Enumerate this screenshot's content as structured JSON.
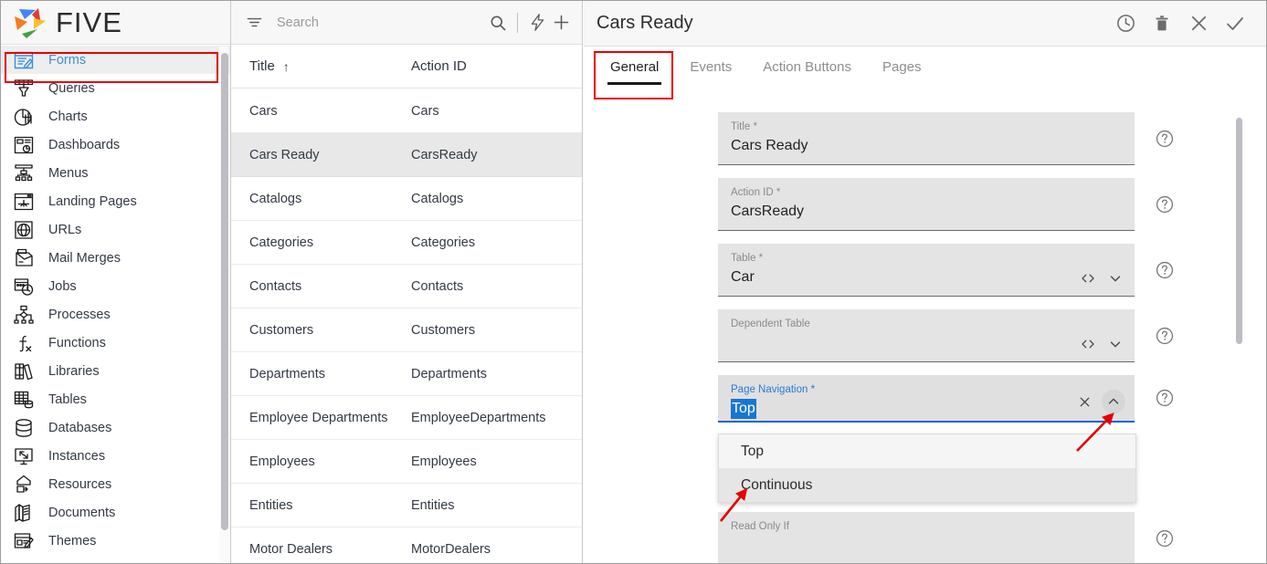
{
  "app": {
    "logo_text": "FIVE",
    "accent_red": "#e60000",
    "accent_blue": "#1876d2",
    "selected_row_bg": "#e8e8e8"
  },
  "sidebar": {
    "items": [
      {
        "label": "Forms",
        "icon": "forms-icon",
        "selected": true
      },
      {
        "label": "Queries",
        "icon": "queries-icon",
        "selected": false
      },
      {
        "label": "Charts",
        "icon": "charts-icon",
        "selected": false
      },
      {
        "label": "Dashboards",
        "icon": "dashboards-icon",
        "selected": false
      },
      {
        "label": "Menus",
        "icon": "menus-icon",
        "selected": false
      },
      {
        "label": "Landing Pages",
        "icon": "landing-pages-icon",
        "selected": false
      },
      {
        "label": "URLs",
        "icon": "urls-icon",
        "selected": false
      },
      {
        "label": "Mail Merges",
        "icon": "mail-merges-icon",
        "selected": false
      },
      {
        "label": "Jobs",
        "icon": "jobs-icon",
        "selected": false
      },
      {
        "label": "Processes",
        "icon": "processes-icon",
        "selected": false
      },
      {
        "label": "Functions",
        "icon": "functions-icon",
        "selected": false
      },
      {
        "label": "Libraries",
        "icon": "libraries-icon",
        "selected": false
      },
      {
        "label": "Tables",
        "icon": "tables-icon",
        "selected": false
      },
      {
        "label": "Databases",
        "icon": "databases-icon",
        "selected": false
      },
      {
        "label": "Instances",
        "icon": "instances-icon",
        "selected": false
      },
      {
        "label": "Resources",
        "icon": "resources-icon",
        "selected": false
      },
      {
        "label": "Documents",
        "icon": "documents-icon",
        "selected": false
      },
      {
        "label": "Themes",
        "icon": "themes-icon",
        "selected": false
      }
    ]
  },
  "list_pane": {
    "search": {
      "placeholder": "Search",
      "value": ""
    },
    "toolbar_icons": [
      "filter-icon",
      "search-icon",
      "lightning-icon",
      "plus-icon"
    ],
    "columns": [
      {
        "label": "Title",
        "sort": "ascending",
        "sort_glyph": "↑"
      },
      {
        "label": "Action ID",
        "sort": "none",
        "sort_glyph": ""
      }
    ],
    "rows": [
      {
        "title": "Cars",
        "action_id": "Cars",
        "selected": false
      },
      {
        "title": "Cars Ready",
        "action_id": "CarsReady",
        "selected": true
      },
      {
        "title": "Catalogs",
        "action_id": "Catalogs",
        "selected": false
      },
      {
        "title": "Categories",
        "action_id": "Categories",
        "selected": false
      },
      {
        "title": "Contacts",
        "action_id": "Contacts",
        "selected": false
      },
      {
        "title": "Customers",
        "action_id": "Customers",
        "selected": false
      },
      {
        "title": "Departments",
        "action_id": "Departments",
        "selected": false
      },
      {
        "title": "Employee Departments",
        "action_id": "EmployeeDepartments",
        "selected": false
      },
      {
        "title": "Employees",
        "action_id": "Employees",
        "selected": false
      },
      {
        "title": "Entities",
        "action_id": "Entities",
        "selected": false
      },
      {
        "title": "Motor Dealers",
        "action_id": "MotorDealers",
        "selected": false
      }
    ]
  },
  "detail": {
    "title": "Cars Ready",
    "header_icons": [
      "history-clock-icon",
      "delete-trash-icon",
      "close-x-icon",
      "confirm-check-icon"
    ],
    "tabs": [
      {
        "label": "General",
        "active": true
      },
      {
        "label": "Events",
        "active": false
      },
      {
        "label": "Action Buttons",
        "active": false
      },
      {
        "label": "Pages",
        "active": false
      }
    ],
    "fields": [
      {
        "label": "Title *",
        "value": "Cars Ready",
        "adornments": [],
        "focused": false,
        "selected_text": false
      },
      {
        "label": "Action ID *",
        "value": "CarsReady",
        "adornments": [],
        "focused": false,
        "selected_text": false
      },
      {
        "label": "Table *",
        "value": "Car",
        "adornments": [
          "code-icon",
          "chevron-down-icon"
        ],
        "focused": false,
        "selected_text": false
      },
      {
        "label": "Dependent Table",
        "value": "",
        "adornments": [
          "code-icon",
          "chevron-down-icon"
        ],
        "focused": false,
        "selected_text": false
      },
      {
        "label": "Page Navigation *",
        "value": "Top",
        "adornments": [
          "clear-x-icon",
          "chevron-up-icon"
        ],
        "focused": true,
        "selected_text": true
      },
      {
        "label": "Read Only If",
        "value": "",
        "adornments": [],
        "focused": false,
        "selected_text": false
      }
    ],
    "dropdown": {
      "open": true,
      "options": [
        {
          "label": "Top",
          "state": "selected"
        },
        {
          "label": "Continuous",
          "state": "hovered"
        }
      ]
    },
    "help_icon": "question-mark-help-icon"
  },
  "annotations": {
    "boxes": [
      {
        "target": "sidebar-item-forms",
        "color": "#e60000"
      },
      {
        "target": "tab-general",
        "color": "#e60000"
      }
    ],
    "arrows": [
      {
        "target": "page-navigation-chevron-up",
        "color": "#e60000"
      },
      {
        "target": "dropdown-option-continuous",
        "color": "#e60000"
      }
    ]
  }
}
